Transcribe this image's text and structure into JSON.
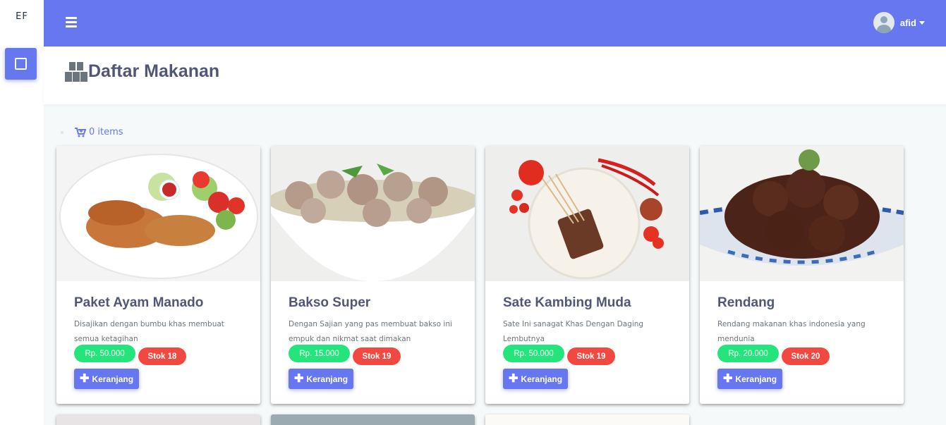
{
  "sidebar": {
    "brand": "EF"
  },
  "topbar": {
    "user_name": "afid"
  },
  "page": {
    "title": "Daftar Makanan"
  },
  "cart": {
    "items_label": "0 items"
  },
  "products": [
    {
      "name": "Paket Ayam Manado",
      "description": "Disajikan dengan bumbu khas membuat semua ketagihan",
      "price": "Rp. 50.000",
      "stock": "Stok 18",
      "button": "Keranjang"
    },
    {
      "name": "Bakso Super",
      "description": "Dengan Sajian yang pas membuat bakso ini empuk dan nikmat saat dimakan",
      "price": "Rp. 15.000",
      "stock": "Stok 19",
      "button": "Keranjang"
    },
    {
      "name": "Sate Kambing Muda",
      "description": "Sate Ini sanagat Khas Dengan Daging Lembutnya",
      "price": "Rp. 50.000",
      "stock": "Stok 19",
      "button": "Keranjang"
    },
    {
      "name": "Rendang",
      "description": "Rendang makanan khas indonesia yang mendunia",
      "price": "Rp. 20.000",
      "stock": "Stok 20",
      "button": "Keranjang"
    }
  ],
  "colors": {
    "primary": "#6777ef",
    "success": "#23e57b",
    "danger": "#f24842"
  }
}
